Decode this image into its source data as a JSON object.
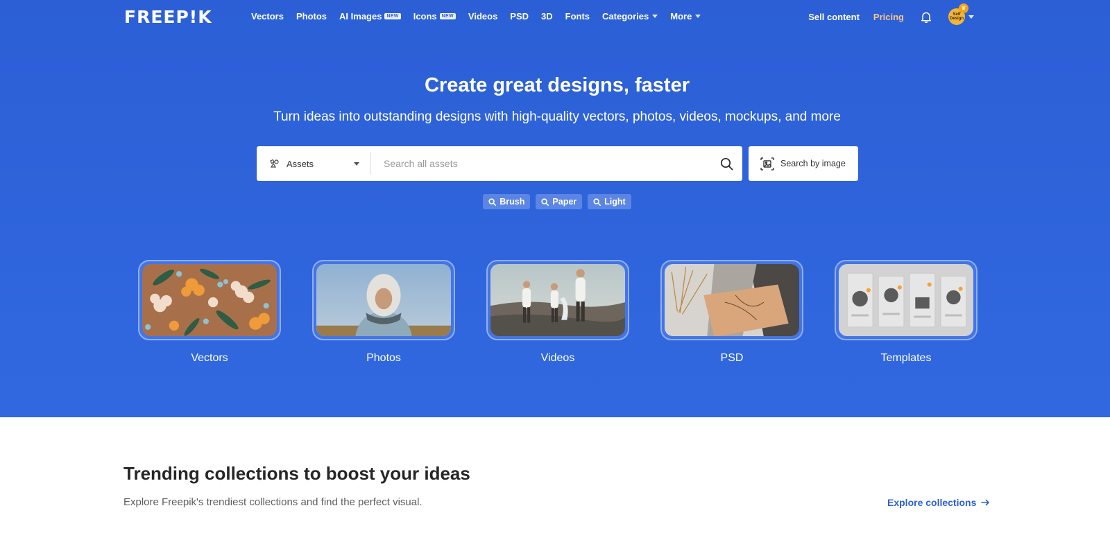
{
  "brand": {
    "logo_text": "FREEP!K"
  },
  "nav": {
    "links": [
      {
        "label": "Vectors",
        "badge": "",
        "dropdown": false
      },
      {
        "label": "Photos",
        "badge": "",
        "dropdown": false
      },
      {
        "label": "AI Images",
        "badge": "NEW",
        "dropdown": false
      },
      {
        "label": "Icons",
        "badge": "NEW",
        "dropdown": false
      },
      {
        "label": "Videos",
        "badge": "",
        "dropdown": false
      },
      {
        "label": "PSD",
        "badge": "",
        "dropdown": false
      },
      {
        "label": "3D",
        "badge": "",
        "dropdown": false
      },
      {
        "label": "Fonts",
        "badge": "",
        "dropdown": false
      },
      {
        "label": "Categories",
        "badge": "",
        "dropdown": true
      },
      {
        "label": "More",
        "badge": "",
        "dropdown": true
      }
    ],
    "sell_label": "Sell content",
    "pricing_label": "Pricing",
    "bell_icon": "bell-icon",
    "avatar_text": "Self Design",
    "avatar_icon": "crown-icon"
  },
  "hero": {
    "title": "Create great designs, faster",
    "subtitle": "Turn ideas into outstanding designs with high-quality vectors, photos, videos, mockups, and more"
  },
  "search": {
    "type_label": "Assets",
    "type_icon": "assets-shapes-icon",
    "placeholder": "Search all assets",
    "value": "",
    "search_icon": "magnifier-icon",
    "image_search_label": "Search by image",
    "image_search_icon": "image-search-icon"
  },
  "suggestions": [
    "Brush",
    "Paper",
    "Light"
  ],
  "categories": [
    {
      "label": "Vectors"
    },
    {
      "label": "Photos"
    },
    {
      "label": "Videos"
    },
    {
      "label": "PSD"
    },
    {
      "label": "Templates"
    }
  ],
  "trending": {
    "title": "Trending collections to boost your ideas",
    "subtitle": "Explore Freepik's trendiest collections and find the perfect visual.",
    "explore_label": "Explore collections"
  },
  "colors": {
    "hero_bg": "#2c5fd6",
    "pricing": "#f7c58b",
    "link": "#2c5fd6"
  }
}
